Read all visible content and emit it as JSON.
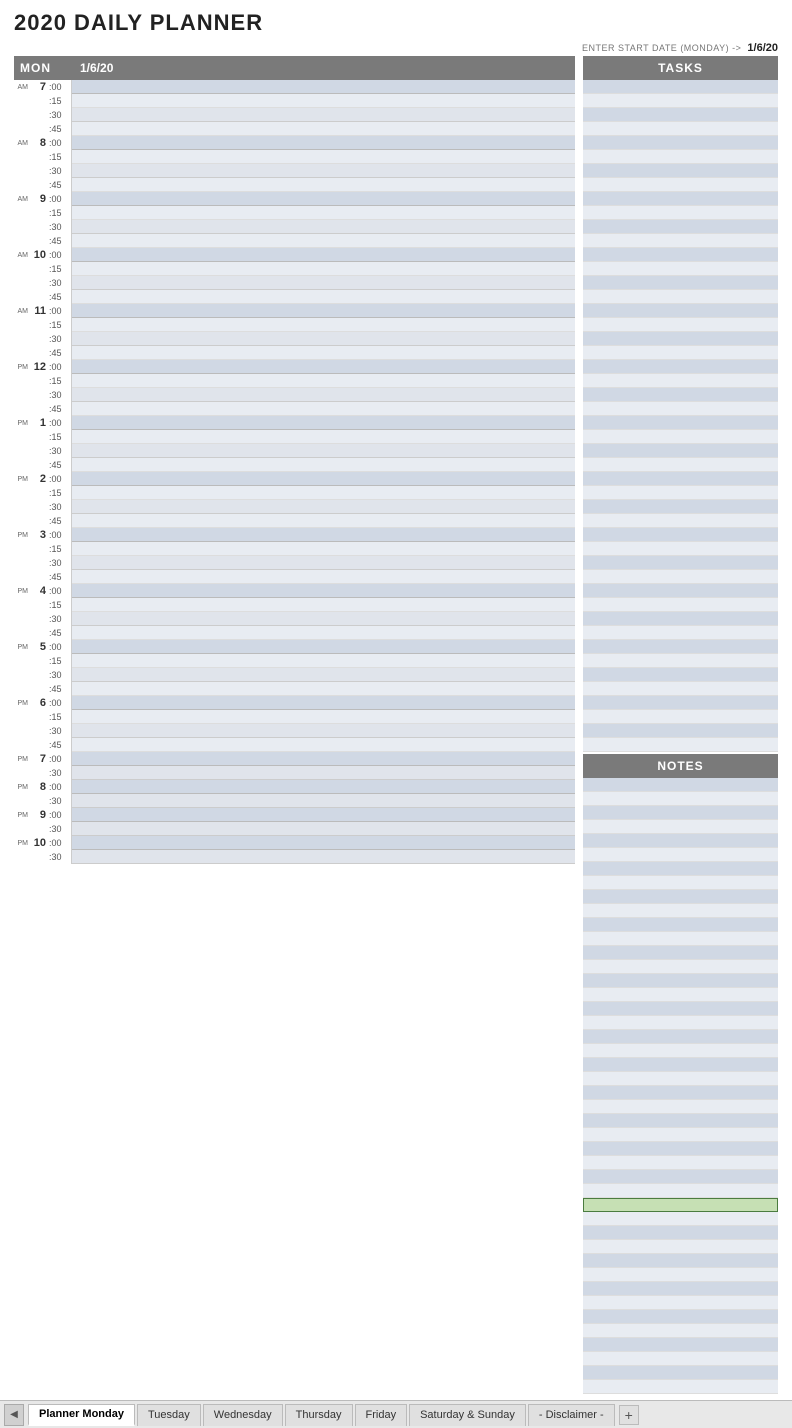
{
  "title": "2020 DAILY PLANNER",
  "startDateLabel": "ENTER START DATE (MONDAY) ->",
  "startDate": "1/6/20",
  "dayHeader": "MON",
  "dateHeader": "1/6/20",
  "tasksHeader": "TASKS",
  "notesHeader": "NOTES",
  "hours": [
    {
      "hour": "7",
      "ampm": "AM"
    },
    {
      "hour": "8",
      "ampm": "AM"
    },
    {
      "hour": "9",
      "ampm": "AM"
    },
    {
      "hour": "10",
      "ampm": "AM"
    },
    {
      "hour": "11",
      "ampm": "AM"
    },
    {
      "hour": "12",
      "ampm": "PM"
    },
    {
      "hour": "1",
      "ampm": "PM"
    },
    {
      "hour": "2",
      "ampm": "PM"
    },
    {
      "hour": "3",
      "ampm": "PM"
    },
    {
      "hour": "4",
      "ampm": "PM"
    },
    {
      "hour": "5",
      "ampm": "PM"
    },
    {
      "hour": "6",
      "ampm": "PM"
    },
    {
      "hour": "7",
      "ampm": "PM"
    },
    {
      "hour": "8",
      "ampm": "PM"
    },
    {
      "hour": "9",
      "ampm": "PM"
    },
    {
      "hour": "10",
      "ampm": "PM"
    }
  ],
  "hours7pm": [
    "7",
    "8",
    "9",
    "10"
  ],
  "tabs": [
    {
      "label": "Planner Monday",
      "active": true
    },
    {
      "label": "Tuesday",
      "active": false
    },
    {
      "label": "Wednesday",
      "active": false
    },
    {
      "label": "Thursday",
      "active": false
    },
    {
      "label": "Friday",
      "active": false
    },
    {
      "label": "Saturday & Sunday",
      "active": false
    },
    {
      "label": "- Disclaimer -",
      "active": false
    }
  ]
}
